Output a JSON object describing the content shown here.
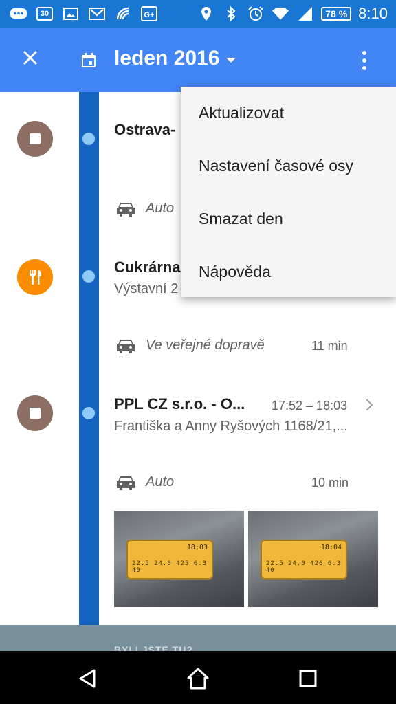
{
  "status_bar": {
    "calendar_day": "30",
    "battery": "78 %",
    "time": "8:10",
    "icons": [
      "messages-icon",
      "calendar-icon",
      "image-icon",
      "gmail-icon",
      "hangouts-icon",
      "google-plus-icon",
      "location-icon",
      "bluetooth-icon",
      "alarm-icon",
      "wifi-icon",
      "signal-icon",
      "battery-icon"
    ]
  },
  "app_bar": {
    "title": "leden 2016",
    "icons": [
      "close-icon",
      "calendar-icon",
      "dropdown-arrow-icon",
      "more-vert-icon"
    ],
    "accent": "#4285f4"
  },
  "timeline": {
    "entries": [
      {
        "title": "Ostrava-",
        "icon": "stop-icon",
        "color": "#8d6e63"
      },
      {
        "travel_mode": "Auto",
        "icon": "car-icon"
      },
      {
        "title": "Cukrárna",
        "subtitle": "Výstavní 2",
        "icon": "restaurant-icon",
        "color": "#fb8c00"
      },
      {
        "travel_mode": "Ve veřejné dopravě",
        "duration": "11 min",
        "icon": "car-icon"
      },
      {
        "title": "PPL CZ s.r.o. - O...",
        "time": "17:52 – 18:03",
        "subtitle": "Františka a Anny Ryšových 1168/21,...",
        "icon": "stop-icon",
        "color": "#8d6e63"
      },
      {
        "travel_mode": "Auto",
        "duration": "10 min",
        "icon": "car-icon"
      }
    ],
    "photos": [
      {
        "lcd_time": "18:03",
        "lcd_values": "22.5 24.0 425 6.3 40"
      },
      {
        "lcd_time": "18:04",
        "lcd_values": "22.5 24.0 426 6.3 40"
      }
    ],
    "banner": "BYLI JSTE TU?"
  },
  "menu": {
    "items": [
      "Aktualizovat",
      "Nastavení časové osy",
      "Smazat den",
      "Nápověda"
    ]
  },
  "nav_bar": {
    "icons": [
      "back-icon",
      "home-icon",
      "recents-icon"
    ]
  }
}
